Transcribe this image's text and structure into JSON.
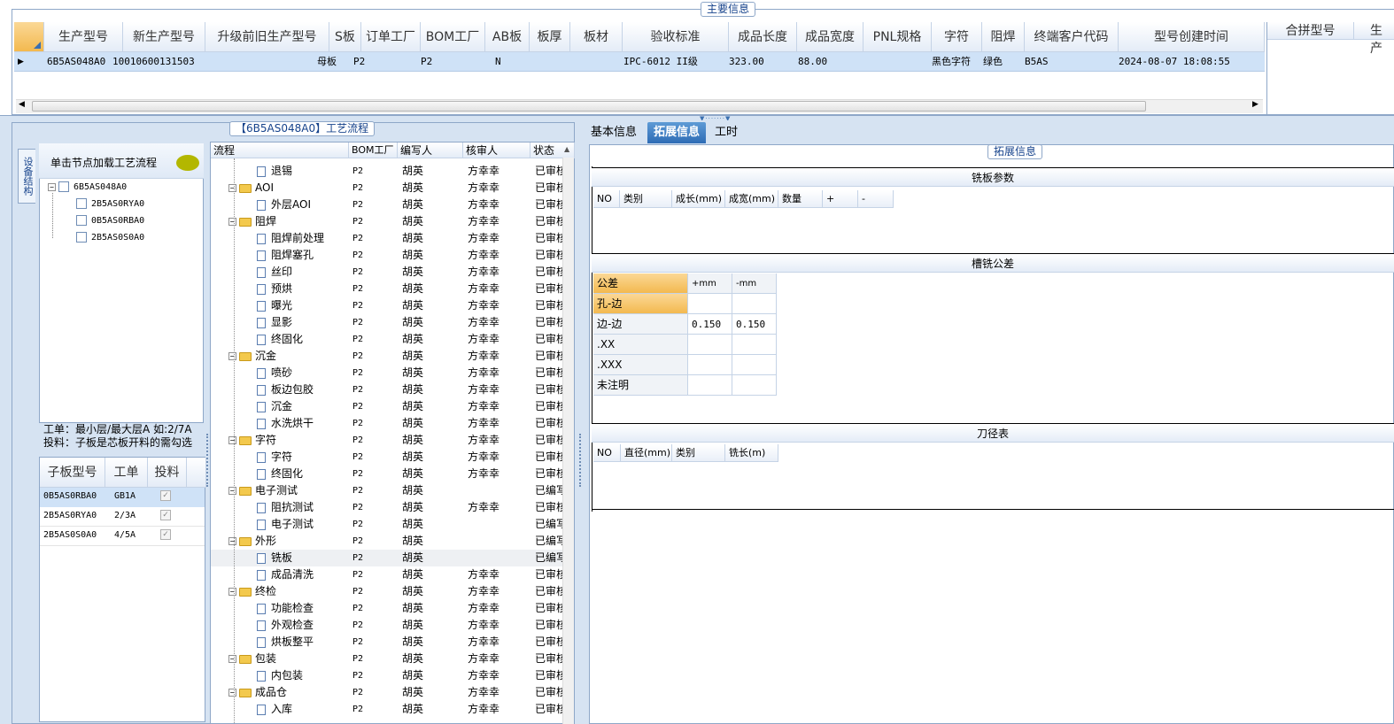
{
  "main_info": {
    "title": "主要信息",
    "columns": [
      "生产型号",
      "新生产型号",
      "升级前旧生产型号",
      "S板",
      "订单工厂",
      "BOM工厂",
      "AB板",
      "板厚",
      "板材",
      "验收标准",
      "成品长度",
      "成品宽度",
      "PNL规格",
      "字符",
      "阻焊",
      "终端客户代码",
      "型号创建时间"
    ],
    "row": [
      "6B5AS048A0",
      "10010600131503",
      "",
      "母板",
      "P2",
      "P2",
      "N",
      "",
      "",
      "IPC-6012 II级",
      "323.00",
      "88.00",
      "",
      "黑色字符",
      "绿色",
      "B5AS",
      "2024-08-07 18:08:55"
    ],
    "right_columns": [
      "合拼型号",
      "生产"
    ]
  },
  "sidebar": {
    "vertical_tab": "设备结构",
    "tree_title": "单击节点加载工艺流程",
    "root": "6B5AS048A0",
    "children": [
      "2B5AS0RYA0",
      "0B5AS0RBA0",
      "2B5AS0S0A0"
    ],
    "note_line1": "工单：最小层/最大层A 如:2/7A",
    "note_line2": "投料：子板是芯板开料的需勾选",
    "sub_columns": [
      "子板型号",
      "工单",
      "投料"
    ],
    "sub_rows": [
      {
        "model": "0B5AS0RBA0",
        "order": "GB1A",
        "feed": "✓"
      },
      {
        "model": "2B5AS0RYA0",
        "order": "2/3A",
        "feed": "✓"
      },
      {
        "model": "2B5AS0S0A0",
        "order": "4/5A",
        "feed": "✓"
      }
    ]
  },
  "process": {
    "title": "【6B5AS048A0】工艺流程",
    "columns": [
      "流程",
      "BOM工厂",
      "编写人",
      "核审人",
      "状态"
    ],
    "rows": [
      {
        "level": 1,
        "name": "退锡",
        "factory": "P2",
        "writer": "胡英",
        "reviewer": "方幸幸",
        "status": "已审核"
      },
      {
        "level": 0,
        "name": "AOI",
        "factory": "P2",
        "writer": "胡英",
        "reviewer": "方幸幸",
        "status": "已审核"
      },
      {
        "level": 1,
        "name": "外层AOI",
        "factory": "P2",
        "writer": "胡英",
        "reviewer": "方幸幸",
        "status": "已审核"
      },
      {
        "level": 0,
        "name": "阻焊",
        "factory": "P2",
        "writer": "胡英",
        "reviewer": "方幸幸",
        "status": "已审核"
      },
      {
        "level": 1,
        "name": "阻焊前处理",
        "factory": "P2",
        "writer": "胡英",
        "reviewer": "方幸幸",
        "status": "已审核"
      },
      {
        "level": 1,
        "name": "阻焊塞孔",
        "factory": "P2",
        "writer": "胡英",
        "reviewer": "方幸幸",
        "status": "已审核"
      },
      {
        "level": 1,
        "name": "丝印",
        "factory": "P2",
        "writer": "胡英",
        "reviewer": "方幸幸",
        "status": "已审核"
      },
      {
        "level": 1,
        "name": "预烘",
        "factory": "P2",
        "writer": "胡英",
        "reviewer": "方幸幸",
        "status": "已审核"
      },
      {
        "level": 1,
        "name": "曝光",
        "factory": "P2",
        "writer": "胡英",
        "reviewer": "方幸幸",
        "status": "已审核"
      },
      {
        "level": 1,
        "name": "显影",
        "factory": "P2",
        "writer": "胡英",
        "reviewer": "方幸幸",
        "status": "已审核"
      },
      {
        "level": 1,
        "name": "终固化",
        "factory": "P2",
        "writer": "胡英",
        "reviewer": "方幸幸",
        "status": "已审核"
      },
      {
        "level": 0,
        "name": "沉金",
        "factory": "P2",
        "writer": "胡英",
        "reviewer": "方幸幸",
        "status": "已审核"
      },
      {
        "level": 1,
        "name": "喷砂",
        "factory": "P2",
        "writer": "胡英",
        "reviewer": "方幸幸",
        "status": "已审核"
      },
      {
        "level": 1,
        "name": "板边包胶",
        "factory": "P2",
        "writer": "胡英",
        "reviewer": "方幸幸",
        "status": "已审核"
      },
      {
        "level": 1,
        "name": "沉金",
        "factory": "P2",
        "writer": "胡英",
        "reviewer": "方幸幸",
        "status": "已审核"
      },
      {
        "level": 1,
        "name": "水洗烘干",
        "factory": "P2",
        "writer": "胡英",
        "reviewer": "方幸幸",
        "status": "已审核"
      },
      {
        "level": 0,
        "name": "字符",
        "factory": "P2",
        "writer": "胡英",
        "reviewer": "方幸幸",
        "status": "已审核"
      },
      {
        "level": 1,
        "name": "字符",
        "factory": "P2",
        "writer": "胡英",
        "reviewer": "方幸幸",
        "status": "已审核"
      },
      {
        "level": 1,
        "name": "终固化",
        "factory": "P2",
        "writer": "胡英",
        "reviewer": "方幸幸",
        "status": "已审核"
      },
      {
        "level": 0,
        "name": "电子测试",
        "factory": "P2",
        "writer": "胡英",
        "reviewer": "",
        "status": "已编写"
      },
      {
        "level": 1,
        "name": "阻抗测试",
        "factory": "P2",
        "writer": "胡英",
        "reviewer": "方幸幸",
        "status": "已审核"
      },
      {
        "level": 1,
        "name": "电子测试",
        "factory": "P2",
        "writer": "胡英",
        "reviewer": "",
        "status": "已编写"
      },
      {
        "level": 0,
        "name": "外形",
        "factory": "P2",
        "writer": "胡英",
        "reviewer": "",
        "status": "已编写"
      },
      {
        "level": 1,
        "name": "铣板",
        "factory": "P2",
        "writer": "胡英",
        "reviewer": "",
        "status": "已编写"
      },
      {
        "level": 1,
        "name": "成品清洗",
        "factory": "P2",
        "writer": "胡英",
        "reviewer": "方幸幸",
        "status": "已审核"
      },
      {
        "level": 0,
        "name": "终检",
        "factory": "P2",
        "writer": "胡英",
        "reviewer": "方幸幸",
        "status": "已审核"
      },
      {
        "level": 1,
        "name": "功能检查",
        "factory": "P2",
        "writer": "胡英",
        "reviewer": "方幸幸",
        "status": "已审核"
      },
      {
        "level": 1,
        "name": "外观检查",
        "factory": "P2",
        "writer": "胡英",
        "reviewer": "方幸幸",
        "status": "已审核"
      },
      {
        "level": 1,
        "name": "烘板整平",
        "factory": "P2",
        "writer": "胡英",
        "reviewer": "方幸幸",
        "status": "已审核"
      },
      {
        "level": 0,
        "name": "包装",
        "factory": "P2",
        "writer": "胡英",
        "reviewer": "方幸幸",
        "status": "已审核"
      },
      {
        "level": 1,
        "name": "内包装",
        "factory": "P2",
        "writer": "胡英",
        "reviewer": "方幸幸",
        "status": "已审核"
      },
      {
        "level": 0,
        "name": "成品仓",
        "factory": "P2",
        "writer": "胡英",
        "reviewer": "方幸幸",
        "status": "已审核"
      },
      {
        "level": 1,
        "name": "入库",
        "factory": "P2",
        "writer": "胡英",
        "reviewer": "方幸幸",
        "status": "已审核"
      }
    ]
  },
  "right": {
    "tabs": [
      "基本信息",
      "拓展信息",
      "工时"
    ],
    "active_tab": "拓展信息",
    "group_title": "拓展信息",
    "milling_title": "铣板参数",
    "milling_columns": [
      "NO",
      "类别",
      "成长(mm)",
      "成宽(mm)",
      "数量",
      "+",
      "-"
    ],
    "tolerance_title": "槽铣公差",
    "tolerance_header": [
      "公差",
      "+mm",
      "-mm"
    ],
    "tolerance_rows": [
      {
        "label": "孔-边",
        "plus": "",
        "minus": ""
      },
      {
        "label": "边-边",
        "plus": "0.150",
        "minus": "0.150"
      },
      {
        "label": ".XX",
        "plus": "",
        "minus": ""
      },
      {
        "label": ".XXX",
        "plus": "",
        "minus": ""
      },
      {
        "label": "未注明",
        "plus": "",
        "minus": ""
      }
    ],
    "tool_title": "刀径表",
    "tool_columns": [
      "NO",
      "直径(mm)",
      "类别",
      "铣长(m)"
    ]
  }
}
